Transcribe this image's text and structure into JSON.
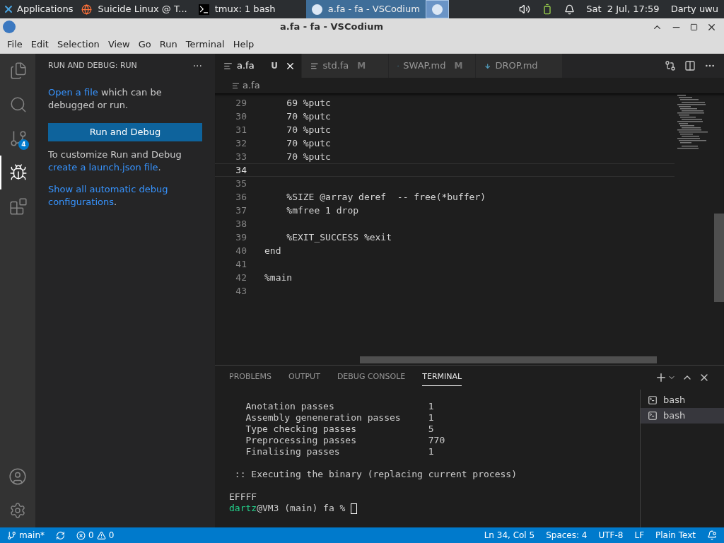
{
  "taskbar": {
    "menu": "Applications",
    "tasks": [
      {
        "label": "Suicide Linux @ T...",
        "kind": "browser",
        "selected": false
      },
      {
        "label": "tmux: 1 bash",
        "kind": "terminal",
        "selected": false
      },
      {
        "label": "a.fa - fa - VSCodium",
        "kind": "editor",
        "selected": true
      }
    ],
    "clock": "Sat  2 Jul, 17:59",
    "user": "Darty uwu"
  },
  "window": {
    "title": "a.fa - fa - VSCodium"
  },
  "menu": [
    "File",
    "Edit",
    "Selection",
    "View",
    "Go",
    "Run",
    "Terminal",
    "Help"
  ],
  "activity_bar": [
    {
      "kind": "files",
      "selected": false
    },
    {
      "kind": "search",
      "selected": false
    },
    {
      "kind": "source-control",
      "selected": false,
      "badge": "4"
    },
    {
      "kind": "run-debug",
      "selected": true
    },
    {
      "kind": "extensions",
      "selected": false
    }
  ],
  "sidebar": {
    "title": "RUN AND DEBUG: RUN",
    "more": "···",
    "intro_link": "Open a file",
    "intro_rest": " which can be debugged or run.",
    "button": "Run and Debug",
    "customize": "To customize Run and Debug",
    "launch_link": "create a launch.json file",
    "show_link": "Show all automatic debug configurations",
    "period": "."
  },
  "tabs": [
    {
      "label": "a.fa",
      "status": "U",
      "kind": "text",
      "selected": true
    },
    {
      "label": "std.fa",
      "status": "M",
      "kind": "text",
      "selected": false
    },
    {
      "label": "SWAP.md",
      "status": "M",
      "kind": "markdown",
      "selected": false
    },
    {
      "label": "DROP.md",
      "kind": "markdown",
      "selected": false
    }
  ],
  "breadcrumb": "a.fa",
  "code": [
    {
      "number": "29",
      "text": "    69 %putc",
      "current": false
    },
    {
      "number": "30",
      "text": "    70 %putc",
      "current": false
    },
    {
      "number": "31",
      "text": "    70 %putc",
      "current": false
    },
    {
      "number": "32",
      "text": "    70 %putc",
      "current": false
    },
    {
      "number": "33",
      "text": "    70 %putc",
      "current": false
    },
    {
      "number": "34",
      "current": true
    },
    {
      "number": "35",
      "current": false
    },
    {
      "number": "36",
      "text": "    %SIZE @array deref  -- free(*buffer)",
      "current": false
    },
    {
      "number": "37",
      "text": "    %mfree 1 drop",
      "current": false
    },
    {
      "number": "38",
      "current": false
    },
    {
      "number": "39",
      "text": "    %EXIT_SUCCESS %exit",
      "current": false
    },
    {
      "number": "40",
      "text": "end",
      "current": false
    },
    {
      "number": "41",
      "current": false
    },
    {
      "number": "42",
      "text": "%main",
      "current": false
    },
    {
      "number": "43",
      "current": false
    }
  ],
  "panel_tabs": [
    {
      "label": "PROBLEMS",
      "selected": false
    },
    {
      "label": "OUTPUT",
      "selected": false
    },
    {
      "label": "DEBUG CONSOLE",
      "selected": false
    },
    {
      "label": "TERMINAL",
      "selected": true
    }
  ],
  "terminal": {
    "lines": [
      {
        "kind": "blank"
      },
      {
        "kind": "text",
        "text": "   Anotation passes                 1"
      },
      {
        "kind": "text",
        "text": "   Assembly geneneration passes     1"
      },
      {
        "kind": "text",
        "text": "   Type checking passes             5"
      },
      {
        "kind": "text",
        "text": "   Preprocessing passes             770"
      },
      {
        "kind": "text",
        "text": "   Finalising passes                1"
      },
      {
        "kind": "blank"
      },
      {
        "kind": "text",
        "text": " :: Executing the binary (replacing current process)"
      },
      {
        "kind": "blank"
      },
      {
        "kind": "text",
        "text": "EFFFF"
      }
    ],
    "prompt_user": "dartz",
    "prompt_rest": "@VM3 (main) fa % "
  },
  "terminal_list": [
    {
      "label": "bash",
      "selected": false
    },
    {
      "label": "bash",
      "selected": true
    }
  ],
  "status_bar": {
    "branch": "main*",
    "errors": "0",
    "warnings": "0",
    "position": "Ln 34, Col 5",
    "spaces": "Spaces: 4",
    "encoding": "UTF-8",
    "eol": "LF",
    "language": "Plain Text"
  }
}
